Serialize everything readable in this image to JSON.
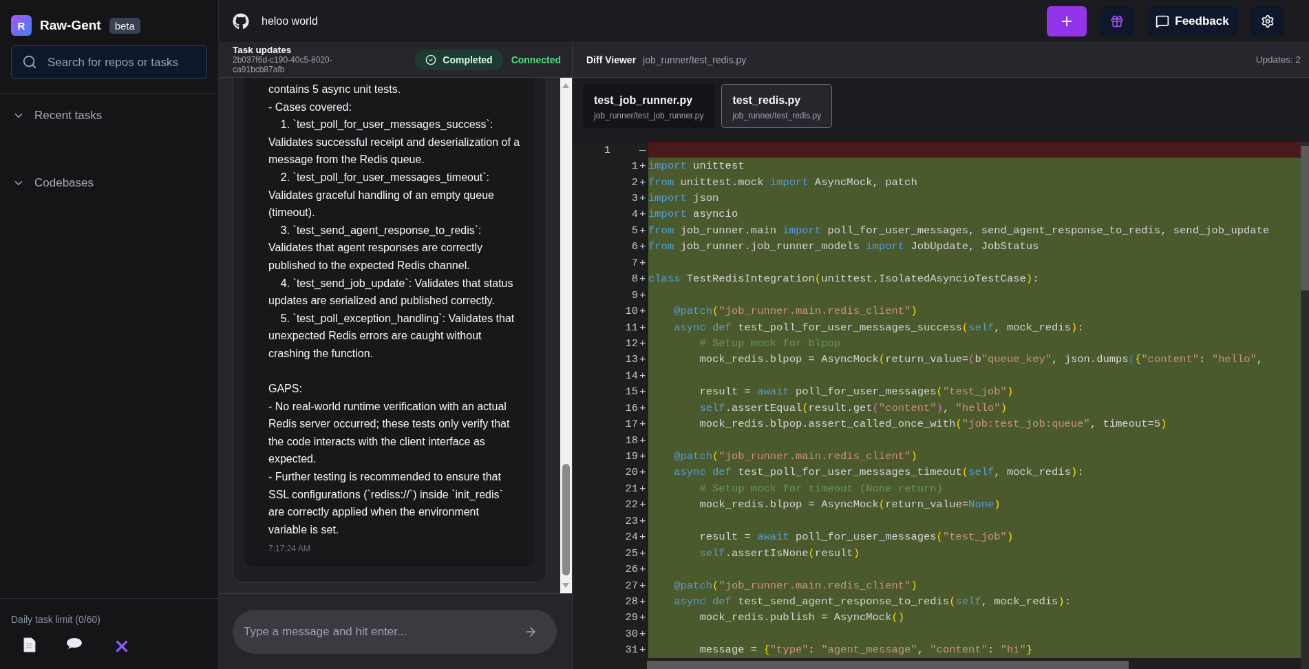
{
  "sidebar": {
    "logo_letter": "R",
    "app_name": "Raw-Gent",
    "badge": "beta",
    "search": {
      "placeholder": "Search for repos or tasks"
    },
    "sections": [
      {
        "label": "Recent tasks",
        "expanded": true
      },
      {
        "label": "Codebases",
        "expanded": true
      }
    ],
    "limit_text": "Daily task limit (0/60)"
  },
  "header": {
    "repo": "heloo world",
    "feedback": "Feedback"
  },
  "task_panel": {
    "title": "Task updates",
    "task_id": "2b037f6d-c190-40c5-8020-ca91bcb87afb",
    "status": {
      "label": "Completed"
    },
    "connection": {
      "label": "Connected",
      "connected": true
    },
    "message": {
      "text": "contains 5 async unit tests.\n- Cases covered:\n    1. `test_poll_for_user_messages_success`: Validates successful receipt and deserialization of a message from the Redis queue.\n    2. `test_poll_for_user_messages_timeout`: Validates graceful handling of an empty queue (timeout).\n    3. `test_send_agent_response_to_redis`: Validates that agent responses are correctly published to the expected Redis channel.\n    4. `test_send_job_update`: Validates that status updates are serialized and published correctly.\n    5. `test_poll_exception_handling`: Validates that unexpected Redis errors are caught without crashing the function.\n\nGAPS:\n- No real-world runtime verification with an actual Redis server occurred; these tests only verify that the code interacts with the client interface as expected.\n- Further testing is recommended to ensure that SSL configurations (`rediss://`) inside `init_redis` are correctly applied when the environment variable is set.",
      "time": "7:17:24 AM"
    },
    "input": {
      "placeholder": "Type a message and hit enter..."
    }
  },
  "diff_viewer": {
    "title": "Diff Viewer",
    "path": "job_runner/test_redis.py",
    "updates": "Updates: 2",
    "tabs": [
      {
        "name": "test_job_runner.py",
        "path": "job_runner/test_job_runner.py",
        "selected": false
      },
      {
        "name": "test_redis.py",
        "path": "job_runner/test_redis.py",
        "selected": true
      }
    ],
    "lines": [
      {
        "kind": "removed",
        "old_number": "1",
        "sign": "—"
      },
      {
        "kind": "added",
        "new_number": "1",
        "sign": "+",
        "tokens": [
          {
            "kind": "keyword",
            "text": "import"
          },
          {
            "kind": "plain",
            "text": " unittest"
          }
        ]
      },
      {
        "kind": "added",
        "new_number": "2",
        "sign": "+",
        "tokens": [
          {
            "kind": "keyword",
            "text": "from"
          },
          {
            "kind": "plain",
            "text": " unittest.mock "
          },
          {
            "kind": "keyword",
            "text": "import"
          },
          {
            "kind": "plain",
            "text": " AsyncMock, patch"
          }
        ]
      },
      {
        "kind": "added",
        "new_number": "3",
        "sign": "+",
        "tokens": [
          {
            "kind": "keyword",
            "text": "import"
          },
          {
            "kind": "plain",
            "text": " json"
          }
        ]
      },
      {
        "kind": "added",
        "new_number": "4",
        "sign": "+",
        "tokens": [
          {
            "kind": "keyword",
            "text": "import"
          },
          {
            "kind": "plain",
            "text": " asyncio"
          }
        ]
      },
      {
        "kind": "added",
        "new_number": "5",
        "sign": "+",
        "tokens": [
          {
            "kind": "keyword",
            "text": "from"
          },
          {
            "kind": "plain",
            "text": " job_runner.main "
          },
          {
            "kind": "keyword",
            "text": "import"
          },
          {
            "kind": "plain",
            "text": " poll_for_user_messages, send_agent_response_to_redis, send_job_update"
          }
        ]
      },
      {
        "kind": "added",
        "new_number": "6",
        "sign": "+",
        "tokens": [
          {
            "kind": "keyword",
            "text": "from"
          },
          {
            "kind": "plain",
            "text": " job_runner.job_runner_models "
          },
          {
            "kind": "keyword",
            "text": "import"
          },
          {
            "kind": "plain",
            "text": " JobUpdate, JobStatus"
          }
        ]
      },
      {
        "kind": "added",
        "new_number": "7",
        "sign": "+"
      },
      {
        "kind": "added",
        "new_number": "8",
        "sign": "+",
        "tokens": [
          {
            "kind": "keyword",
            "text": "class"
          },
          {
            "kind": "plain",
            "text": " TestRedisIntegration"
          },
          {
            "kind": "bracket1",
            "text": "("
          },
          {
            "kind": "plain",
            "text": "unittest.IsolatedAsyncioTestCase"
          },
          {
            "kind": "bracket1",
            "text": ")"
          },
          {
            "kind": "plain",
            "text": ":"
          }
        ]
      },
      {
        "kind": "added",
        "new_number": "9",
        "sign": "+"
      },
      {
        "kind": "added",
        "new_number": "10",
        "sign": "+",
        "tokens": [
          {
            "kind": "keyword",
            "text": "    @patch"
          },
          {
            "kind": "bracket1",
            "text": "("
          },
          {
            "kind": "string",
            "text": "\"job_runner.main.redis_client\""
          },
          {
            "kind": "bracket1",
            "text": ")"
          }
        ]
      },
      {
        "kind": "added",
        "new_number": "11",
        "sign": "+",
        "tokens": [
          {
            "kind": "keyword",
            "text": "    async def"
          },
          {
            "kind": "plain",
            "text": " test_poll_for_user_messages_success"
          },
          {
            "kind": "bracket1",
            "text": "("
          },
          {
            "kind": "keyword",
            "text": "self"
          },
          {
            "kind": "plain",
            "text": ", mock_redis"
          },
          {
            "kind": "bracket1",
            "text": ")"
          },
          {
            "kind": "plain",
            "text": ":"
          }
        ]
      },
      {
        "kind": "added",
        "new_number": "12",
        "sign": "+",
        "tokens": [
          {
            "kind": "comment",
            "text": "        # Setup mock for blpop"
          }
        ]
      },
      {
        "kind": "added",
        "new_number": "13",
        "sign": "+",
        "tokens": [
          {
            "kind": "plain",
            "text": "        mock_redis.blpop = AsyncMock"
          },
          {
            "kind": "bracket1",
            "text": "("
          },
          {
            "kind": "plain",
            "text": "return_value="
          },
          {
            "kind": "bracket2",
            "text": "("
          },
          {
            "kind": "plain",
            "text": "b"
          },
          {
            "kind": "string",
            "text": "\"queue_key\""
          },
          {
            "kind": "plain",
            "text": ", json.dumps"
          },
          {
            "kind": "bracket3",
            "text": "("
          },
          {
            "kind": "bracket1",
            "text": "{"
          },
          {
            "kind": "string",
            "text": "\"content\""
          },
          {
            "kind": "plain",
            "text": ": "
          },
          {
            "kind": "string",
            "text": "\"hello\""
          },
          {
            "kind": "plain",
            "text": ","
          }
        ]
      },
      {
        "kind": "added",
        "new_number": "14",
        "sign": "+"
      },
      {
        "kind": "added",
        "new_number": "15",
        "sign": "+",
        "tokens": [
          {
            "kind": "plain",
            "text": "        result = "
          },
          {
            "kind": "keyword",
            "text": "await"
          },
          {
            "kind": "plain",
            "text": " poll_for_user_messages"
          },
          {
            "kind": "bracket1",
            "text": "("
          },
          {
            "kind": "string",
            "text": "\"test_job\""
          },
          {
            "kind": "bracket1",
            "text": ")"
          }
        ]
      },
      {
        "kind": "added",
        "new_number": "16",
        "sign": "+",
        "tokens": [
          {
            "kind": "keyword",
            "text": "        self"
          },
          {
            "kind": "plain",
            "text": ".assertEqual"
          },
          {
            "kind": "bracket1",
            "text": "("
          },
          {
            "kind": "plain",
            "text": "result.get"
          },
          {
            "kind": "bracket2",
            "text": "("
          },
          {
            "kind": "string",
            "text": "\"content\""
          },
          {
            "kind": "bracket2",
            "text": ")"
          },
          {
            "kind": "plain",
            "text": ", "
          },
          {
            "kind": "string",
            "text": "\"hello\""
          },
          {
            "kind": "bracket1",
            "text": ")"
          }
        ]
      },
      {
        "kind": "added",
        "new_number": "17",
        "sign": "+",
        "tokens": [
          {
            "kind": "plain",
            "text": "        mock_redis.blpop.assert_called_once_with"
          },
          {
            "kind": "bracket1",
            "text": "("
          },
          {
            "kind": "string",
            "text": "\"job:test_job:queue\""
          },
          {
            "kind": "plain",
            "text": ", timeout=5"
          },
          {
            "kind": "bracket1",
            "text": ")"
          }
        ]
      },
      {
        "kind": "added",
        "new_number": "18",
        "sign": "+"
      },
      {
        "kind": "added",
        "new_number": "19",
        "sign": "+",
        "tokens": [
          {
            "kind": "keyword",
            "text": "    @patch"
          },
          {
            "kind": "bracket1",
            "text": "("
          },
          {
            "kind": "string",
            "text": "\"job_runner.main.redis_client\""
          },
          {
            "kind": "bracket1",
            "text": ")"
          }
        ]
      },
      {
        "kind": "added",
        "new_number": "20",
        "sign": "+",
        "tokens": [
          {
            "kind": "keyword",
            "text": "    async def"
          },
          {
            "kind": "plain",
            "text": " test_poll_for_user_messages_timeout"
          },
          {
            "kind": "bracket1",
            "text": "("
          },
          {
            "kind": "keyword",
            "text": "self"
          },
          {
            "kind": "plain",
            "text": ", mock_redis"
          },
          {
            "kind": "bracket1",
            "text": ")"
          },
          {
            "kind": "plain",
            "text": ":"
          }
        ]
      },
      {
        "kind": "added",
        "new_number": "21",
        "sign": "+",
        "tokens": [
          {
            "kind": "comment",
            "text": "        # Setup mock for timeout (None return)"
          }
        ]
      },
      {
        "kind": "added",
        "new_number": "22",
        "sign": "+",
        "tokens": [
          {
            "kind": "plain",
            "text": "        mock_redis.blpop = AsyncMock"
          },
          {
            "kind": "bracket1",
            "text": "("
          },
          {
            "kind": "plain",
            "text": "return_value="
          },
          {
            "kind": "keyword",
            "text": "None"
          },
          {
            "kind": "bracket1",
            "text": ")"
          }
        ]
      },
      {
        "kind": "added",
        "new_number": "23",
        "sign": "+"
      },
      {
        "kind": "added",
        "new_number": "24",
        "sign": "+",
        "tokens": [
          {
            "kind": "plain",
            "text": "        result = "
          },
          {
            "kind": "keyword",
            "text": "await"
          },
          {
            "kind": "plain",
            "text": " poll_for_user_messages"
          },
          {
            "kind": "bracket1",
            "text": "("
          },
          {
            "kind": "string",
            "text": "\"test_job\""
          },
          {
            "kind": "bracket1",
            "text": ")"
          }
        ]
      },
      {
        "kind": "added",
        "new_number": "25",
        "sign": "+",
        "tokens": [
          {
            "kind": "keyword",
            "text": "        self"
          },
          {
            "kind": "plain",
            "text": ".assertIsNone"
          },
          {
            "kind": "bracket1",
            "text": "("
          },
          {
            "kind": "plain",
            "text": "result"
          },
          {
            "kind": "bracket1",
            "text": ")"
          }
        ]
      },
      {
        "kind": "added",
        "new_number": "26",
        "sign": "+"
      },
      {
        "kind": "added",
        "new_number": "27",
        "sign": "+",
        "tokens": [
          {
            "kind": "keyword",
            "text": "    @patch"
          },
          {
            "kind": "bracket1",
            "text": "("
          },
          {
            "kind": "string",
            "text": "\"job_runner.main.redis_client\""
          },
          {
            "kind": "bracket1",
            "text": ")"
          }
        ]
      },
      {
        "kind": "added",
        "new_number": "28",
        "sign": "+",
        "tokens": [
          {
            "kind": "keyword",
            "text": "    async def"
          },
          {
            "kind": "plain",
            "text": " test_send_agent_response_to_redis"
          },
          {
            "kind": "bracket1",
            "text": "("
          },
          {
            "kind": "keyword",
            "text": "self"
          },
          {
            "kind": "plain",
            "text": ", mock_redis"
          },
          {
            "kind": "bracket1",
            "text": ")"
          },
          {
            "kind": "plain",
            "text": ":"
          }
        ]
      },
      {
        "kind": "added",
        "new_number": "29",
        "sign": "+",
        "tokens": [
          {
            "kind": "plain",
            "text": "        mock_redis.publish = AsyncMock"
          },
          {
            "kind": "bracket1",
            "text": "("
          },
          {
            "kind": "bracket1",
            "text": ")"
          }
        ]
      },
      {
        "kind": "added",
        "new_number": "30",
        "sign": "+"
      },
      {
        "kind": "added",
        "new_number": "31",
        "sign": "+",
        "tokens": [
          {
            "kind": "plain",
            "text": "        message = "
          },
          {
            "kind": "bracket1",
            "text": "{"
          },
          {
            "kind": "string",
            "text": "\"type\""
          },
          {
            "kind": "plain",
            "text": ": "
          },
          {
            "kind": "string",
            "text": "\"agent_message\""
          },
          {
            "kind": "plain",
            "text": ", "
          },
          {
            "kind": "string",
            "text": "\"content\""
          },
          {
            "kind": "plain",
            "text": ": "
          },
          {
            "kind": "string",
            "text": "\"hi\""
          },
          {
            "kind": "bracket1",
            "text": "}"
          }
        ]
      }
    ]
  }
}
